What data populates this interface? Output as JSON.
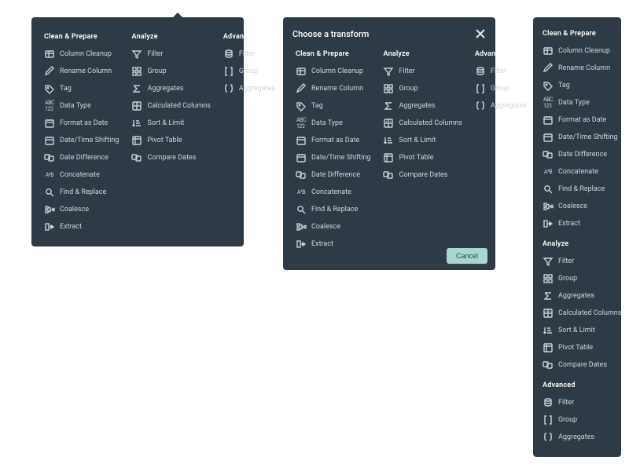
{
  "modal": {
    "title": "Choose a transform",
    "cancel": "Cancel"
  },
  "sections": {
    "clean": {
      "title": "Clean & Prepare"
    },
    "analyze": {
      "title": "Analyze"
    },
    "advanced": {
      "title": "Advanced"
    }
  },
  "items": {
    "column_cleanup": {
      "label": "Column Cleanup"
    },
    "rename_column": {
      "label": "Rename Column"
    },
    "tag": {
      "label": "Tag"
    },
    "data_type": {
      "label": "Data Type"
    },
    "format_as_date": {
      "label": "Format as Date"
    },
    "date_time_shifting": {
      "label": "Date/Time Shifting"
    },
    "date_difference": {
      "label": "Date Difference"
    },
    "concatenate": {
      "label": "Concatenate"
    },
    "find_replace": {
      "label": "Find & Replace"
    },
    "coalesce": {
      "label": "Coalesce"
    },
    "extract": {
      "label": "Extract"
    },
    "filter": {
      "label": "Filter"
    },
    "group": {
      "label": "Group"
    },
    "aggregates": {
      "label": "Aggregates"
    },
    "calculated_columns": {
      "label": "Calculated Columns"
    },
    "sort_limit": {
      "label": "Sort & Limit"
    },
    "pivot_table": {
      "label": "Pivot Table"
    },
    "compare_dates": {
      "label": "Compare Dates"
    },
    "adv_filter": {
      "label": "Filter"
    },
    "adv_group": {
      "label": "Group"
    },
    "adv_aggregates": {
      "label": "Aggregates"
    }
  }
}
